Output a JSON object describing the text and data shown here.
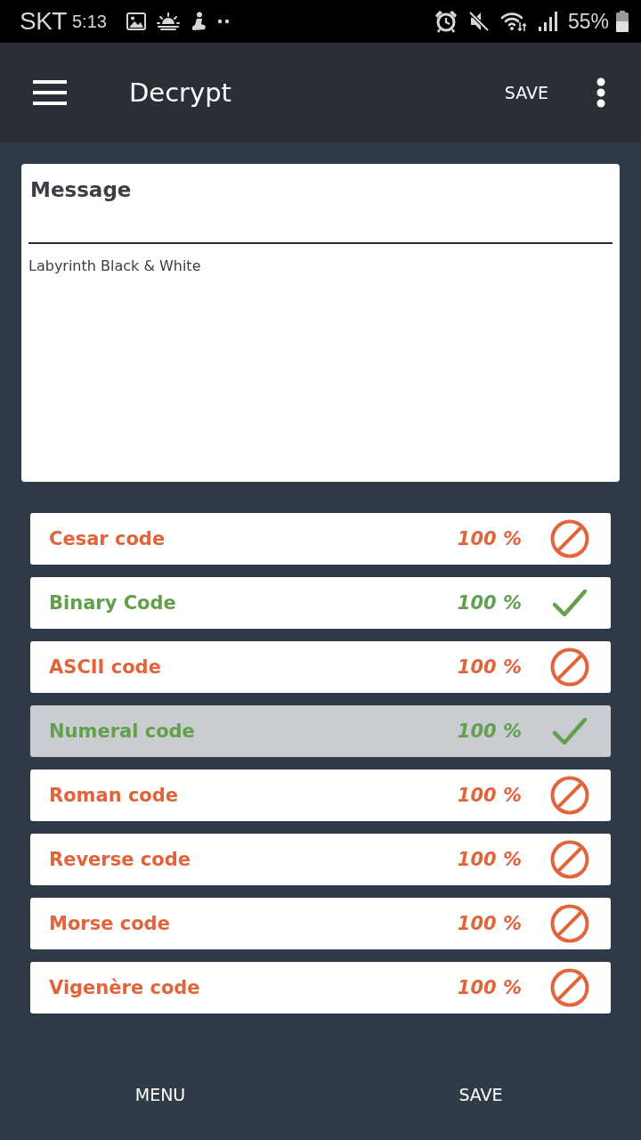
{
  "status_bar": {
    "carrier": "SKT",
    "time": "5:13",
    "battery": "55%"
  },
  "app_bar": {
    "title": "Decrypt",
    "action": "SAVE"
  },
  "message": {
    "label": "Message",
    "value": "Labyrinth Black & White"
  },
  "results": [
    {
      "name": "Cesar code",
      "score": "100 %",
      "matched": false,
      "selected": false
    },
    {
      "name": "Binary Code",
      "score": "100 %",
      "matched": true,
      "selected": false
    },
    {
      "name": "ASCII code",
      "score": "100 %",
      "matched": false,
      "selected": false
    },
    {
      "name": "Numeral code",
      "score": "100 %",
      "matched": true,
      "selected": true
    },
    {
      "name": "Roman code",
      "score": "100 %",
      "matched": false,
      "selected": false
    },
    {
      "name": "Reverse code",
      "score": "100 %",
      "matched": false,
      "selected": false
    },
    {
      "name": "Morse code",
      "score": "100 %",
      "matched": false,
      "selected": false
    },
    {
      "name": "Vigenère code",
      "score": "100 %",
      "matched": false,
      "selected": false
    }
  ],
  "bottom_bar": {
    "buttons": [
      "MENU",
      "SAVE"
    ]
  }
}
